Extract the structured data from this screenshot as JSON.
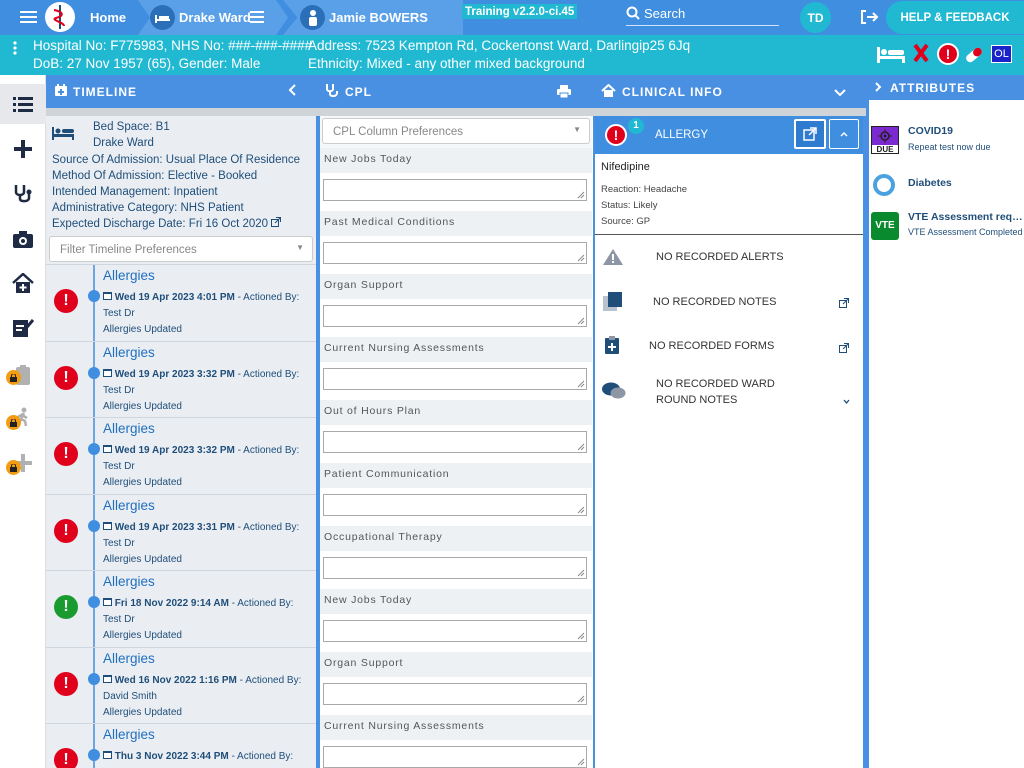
{
  "topbar": {
    "home_label": "Home",
    "ward_label": "Drake Ward",
    "patient_label": "Jamie BOWERS",
    "version": "Training v2.2.0-ci.45",
    "search_label": "Search",
    "user_initials": "TD",
    "help_label": "HELP & FEEDBACK"
  },
  "banner": {
    "hospital_line": "Hospital No: F775983, NHS No: ###-###-####",
    "dob_line": "DoB: 27 Nov 1957 (65), Gender: Male",
    "address_line": "Address: 7523 Kempton Rd, Cockertonst Ward, Darlingip25 6Jq",
    "ethnicity_line": "Ethnicity: Mixed - any other mixed background",
    "ol_badge": "OL"
  },
  "columns": {
    "timeline": "TIMELINE",
    "cpl": "CPL",
    "clinical": "CLINICAL INFO",
    "attributes": "ATTRIBUTES"
  },
  "bed": {
    "bed_space": "Bed Space: B1",
    "ward": "Drake Ward",
    "source": "Source Of Admission: Usual Place Of Residence",
    "method": "Method Of Admission: Elective - Booked",
    "management": "Intended Management: Inpatient",
    "category": "Administrative Category: NHS Patient",
    "discharge": "Expected Discharge Date: Fri 16 Oct 2020"
  },
  "timeline": {
    "filter_placeholder": "Filter Timeline Preferences",
    "items": [
      {
        "title": "Allergies",
        "date": "Wed 19 Apr 2023 4:01 PM",
        "actioned": " - Actioned By:",
        "by": "Test Dr",
        "note": "Allergies Updated",
        "color": "red"
      },
      {
        "title": "Allergies",
        "date": "Wed 19 Apr 2023 3:32 PM",
        "actioned": " - Actioned By:",
        "by": "Test Dr",
        "note": "Allergies Updated",
        "color": "red"
      },
      {
        "title": "Allergies",
        "date": "Wed 19 Apr 2023 3:32 PM",
        "actioned": " - Actioned By:",
        "by": "Test Dr",
        "note": "Allergies Updated",
        "color": "red"
      },
      {
        "title": "Allergies",
        "date": "Wed 19 Apr 2023 3:31 PM",
        "actioned": " - Actioned By:",
        "by": "Test Dr",
        "note": "Allergies Updated",
        "color": "red"
      },
      {
        "title": "Allergies",
        "date": "Fri 18 Nov 2022 9:14 AM",
        "actioned": " - Actioned By:",
        "by": "Test Dr",
        "note": "Allergies Updated",
        "color": "green"
      },
      {
        "title": "Allergies",
        "date": "Wed 16 Nov 2022 1:16 PM",
        "actioned": " - Actioned By:",
        "by": "David Smith",
        "note": "Allergies Updated",
        "color": "red"
      },
      {
        "title": "Allergies",
        "date": "Thu 3 Nov 2022 3:44 PM",
        "actioned": " - Actioned By:",
        "by": "",
        "note": "",
        "color": "red"
      }
    ]
  },
  "cpl": {
    "preferences_placeholder": "CPL Column Preferences",
    "sections": [
      "New Jobs Today",
      "Past Medical Conditions",
      "Organ Support",
      "Current Nursing Assessments",
      "Out of Hours Plan",
      "Patient Communication",
      "Occupational Therapy",
      "New Jobs Today",
      "Organ Support",
      "Current Nursing Assessments"
    ]
  },
  "clinical": {
    "allergy_title": "ALLERGY",
    "allergy_count": "1",
    "drug": "Nifedipine",
    "reaction": "Reaction: Headache",
    "status": "Status: Likely",
    "source": "Source: GP",
    "alerts": "NO RECORDED ALERTS",
    "notes": "NO RECORDED NOTES",
    "forms": "NO RECORDED FORMS",
    "ward_round": "NO RECORDED WARD ROUND NOTES"
  },
  "attributes": {
    "items": [
      {
        "title": "COVID19",
        "sub": "Repeat test now due",
        "badge": "DUE"
      },
      {
        "title": "Diabetes",
        "sub": ""
      },
      {
        "title": "VTE Assessment required",
        "sub": "VTE Assessment Completed",
        "badge": "VTE"
      }
    ]
  },
  "colors": {
    "primary": "#3f8ee0",
    "banner": "#21b9d2",
    "alert_red": "#e0001b",
    "ok_green": "#1a9b2f"
  }
}
